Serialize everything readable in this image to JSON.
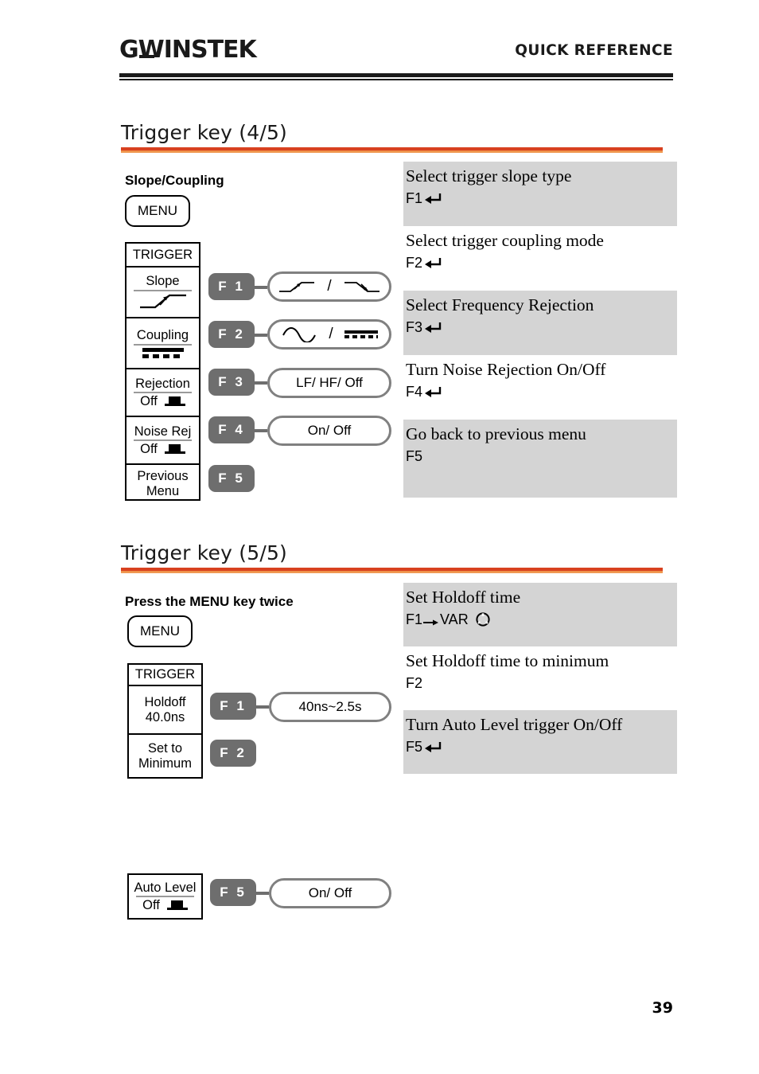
{
  "header": {
    "logo_text": "GWINSTEK",
    "title": "QUICK REFERENCE"
  },
  "page_number": "39",
  "sections": [
    {
      "title": "Trigger key (4/5)",
      "subtitle": "Slope/Coupling",
      "menu_key_label": "MENU",
      "panel": {
        "header": "TRIGGER",
        "cells": [
          {
            "label": "Slope",
            "value": "",
            "icon": "rising-slope-icon"
          },
          {
            "label": "Coupling",
            "value": "",
            "icon": "dc-coupling-icon"
          },
          {
            "label": "Rejection",
            "value": "Off",
            "icon": "toggle-off-icon"
          },
          {
            "label": "Noise Rej",
            "value": "Off",
            "icon": "toggle-off-icon"
          },
          {
            "label": "Previous",
            "label2": "Menu",
            "value": "",
            "icon": ""
          }
        ]
      },
      "fkeys": [
        {
          "label": "F 1",
          "option": "",
          "option_icons": "slope-pair",
          "has_option": true
        },
        {
          "label": "F 2",
          "option": "",
          "option_icons": "coupling-pair",
          "has_option": true
        },
        {
          "label": "F 3",
          "option": "LF/ HF/ Off",
          "has_option": true
        },
        {
          "label": "F 4",
          "option": "On/ Off",
          "has_option": true
        },
        {
          "label": "F 5",
          "option": "",
          "has_option": false
        }
      ],
      "descriptions": [
        {
          "text": "Select trigger slope type",
          "key": "F1",
          "arrow": true,
          "shaded": true
        },
        {
          "text": "Select trigger coupling mode",
          "key": "F2",
          "arrow": true,
          "shaded": false
        },
        {
          "text": "Select Frequency Rejection",
          "key": "F3",
          "arrow": true,
          "shaded": true
        },
        {
          "text": "Turn Noise Rejection On/Off",
          "key": "F4",
          "arrow": true,
          "shaded": false
        },
        {
          "text": "Go back to previous menu",
          "key": "F5",
          "arrow": false,
          "shaded": true
        }
      ]
    },
    {
      "title": "Trigger key (5/5)",
      "subtitle": "Press the MENU key twice",
      "menu_key_label": "MENU",
      "panel": {
        "header": "TRIGGER",
        "cells": [
          {
            "label": "Holdoff",
            "value": "40.0ns"
          },
          {
            "label": "Set to",
            "label2": "Minimum",
            "value": ""
          }
        ]
      },
      "panel2": {
        "label": "Auto Level",
        "value": "Off",
        "icon": "toggle-off-icon"
      },
      "fkeys": [
        {
          "label": "F 1",
          "option": "40ns~2.5s",
          "has_option": true
        },
        {
          "label": "F 2",
          "option": "",
          "has_option": false
        },
        {
          "label": "F 5",
          "option": "On/ Off",
          "has_option": true
        }
      ],
      "descriptions": [
        {
          "text": "Set Holdoff time",
          "key": "F1",
          "key_suffix": "VAR",
          "knob": true,
          "shaded": true
        },
        {
          "text": "Set Holdoff time to minimum",
          "key": "F2",
          "arrow": false,
          "shaded": false
        },
        {
          "text": "Turn Auto Level trigger On/Off",
          "key": "F5",
          "arrow": true,
          "shaded": true
        }
      ]
    }
  ],
  "colors": {
    "accent_rule_top": "#d8411f",
    "accent_rule_bottom": "#f0a05a",
    "shade_band": "#d4d4d4",
    "fkey_gray": "#6e6e6e",
    "option_border": "#808080"
  }
}
